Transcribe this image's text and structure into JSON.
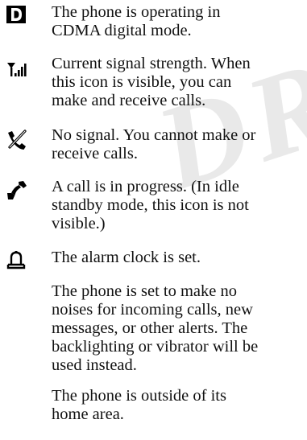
{
  "watermark": "DRA",
  "entries": [
    {
      "icon": "cdma-digital-d-icon",
      "text": "The phone is operating in\nCDMA digital mode."
    },
    {
      "icon": "signal-strength-icon",
      "text": "Current signal strength. When\nthis icon is visible, you can\nmake and receive calls."
    },
    {
      "icon": "no-signal-icon",
      "text": "No signal. You cannot make or\nreceive calls."
    },
    {
      "icon": "call-in-progress-handset-icon",
      "text": "A call is in progress. (In idle\nstandby mode, this icon is not\nvisible.)"
    },
    {
      "icon": "alarm-bell-icon",
      "text": "The alarm clock is set."
    },
    {
      "icon": "",
      "text": "The phone is set to make no\nnoises for incoming calls, new\nmessages, or other alerts. The\nbacklighting or vibrator will be\nused instead."
    },
    {
      "icon": "",
      "text": "The phone is outside of its\nhome area."
    }
  ]
}
